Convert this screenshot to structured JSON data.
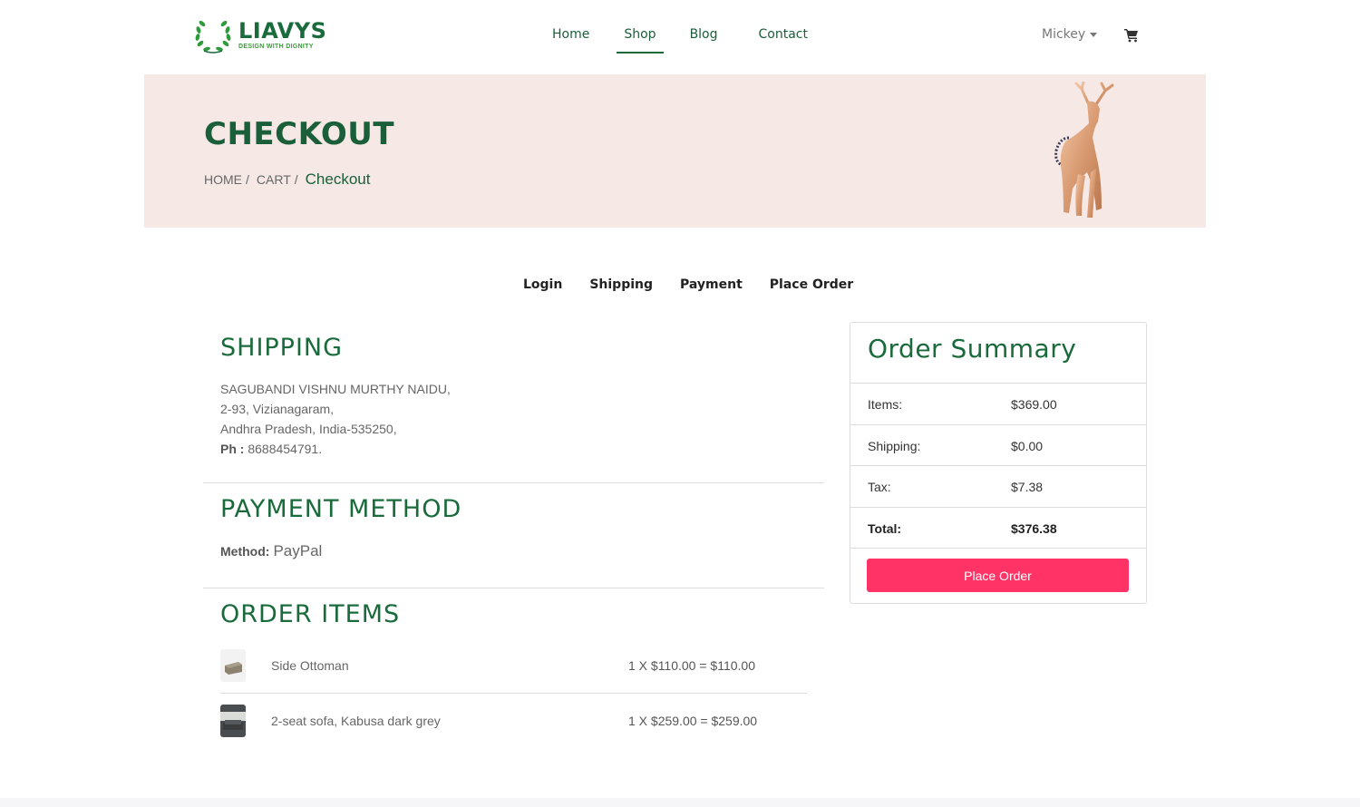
{
  "brand": {
    "name": "LIAVYS",
    "tagline": "DESIGN WITH DIGNITY",
    "color": "#1a6b3c"
  },
  "nav": {
    "items": [
      {
        "label": "Home",
        "active": false
      },
      {
        "label": "Shop",
        "active": true
      },
      {
        "label": "Blog",
        "active": false
      },
      {
        "label": "Contact",
        "active": false
      }
    ]
  },
  "user": {
    "name": "Mickey",
    "cart_icon": "cart-icon"
  },
  "banner": {
    "title": "CHECKOUT",
    "breadcrumb": [
      {
        "label": "HOME"
      },
      {
        "label": "CART"
      },
      {
        "label": "Checkout"
      }
    ],
    "separator": "/"
  },
  "steps": [
    "Login",
    "Shipping",
    "Payment",
    "Place Order"
  ],
  "shipping": {
    "title": "SHIPPING",
    "name": "SAGUBANDI VISHNU MURTHY NAIDU,",
    "line1": "2-93, Vizianagaram,",
    "line2": "Andhra Pradesh, India-535250,",
    "phone_label": "Ph :",
    "phone": "8688454791."
  },
  "payment": {
    "title": "PAYMENT METHOD",
    "label": "Method:",
    "value": "PayPal"
  },
  "order_items": {
    "title": "ORDER ITEMS",
    "items": [
      {
        "name": "Side Ottoman",
        "calc": "1 X $110.00 = $110.00"
      },
      {
        "name": "2-seat sofa, Kabusa dark grey",
        "calc": "1 X $259.00 = $259.00"
      }
    ]
  },
  "summary": {
    "title": "Order Summary",
    "rows": [
      {
        "label": "Items:",
        "value": "$369.00"
      },
      {
        "label": "Shipping:",
        "value": "$0.00"
      },
      {
        "label": "Tax:",
        "value": "$7.38"
      },
      {
        "label": "Total:",
        "value": "$376.38"
      }
    ],
    "button": "Place Order",
    "button_color": "#ff3366"
  }
}
